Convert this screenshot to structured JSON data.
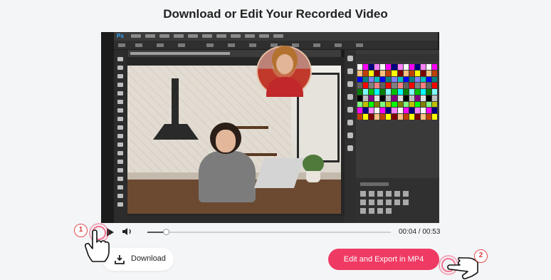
{
  "page": {
    "title": "Download or Edit Your Recorded Video"
  },
  "player": {
    "current_time": "00:04",
    "duration": "00:53",
    "time_display": "00:04 / 00:53",
    "progress_fraction": 0.075
  },
  "actions": {
    "download_label": "Download",
    "export_label": "Edit and Export in MP4"
  },
  "callouts": {
    "step1": "1",
    "step2": "2"
  },
  "colors": {
    "accent": "#ef3a63",
    "callout": "#e24a4a",
    "background": "#f4f5f7"
  },
  "icons": {
    "play": "play-icon",
    "volume": "volume-icon",
    "download": "download-icon",
    "pointer": "hand-pointer-icon"
  }
}
